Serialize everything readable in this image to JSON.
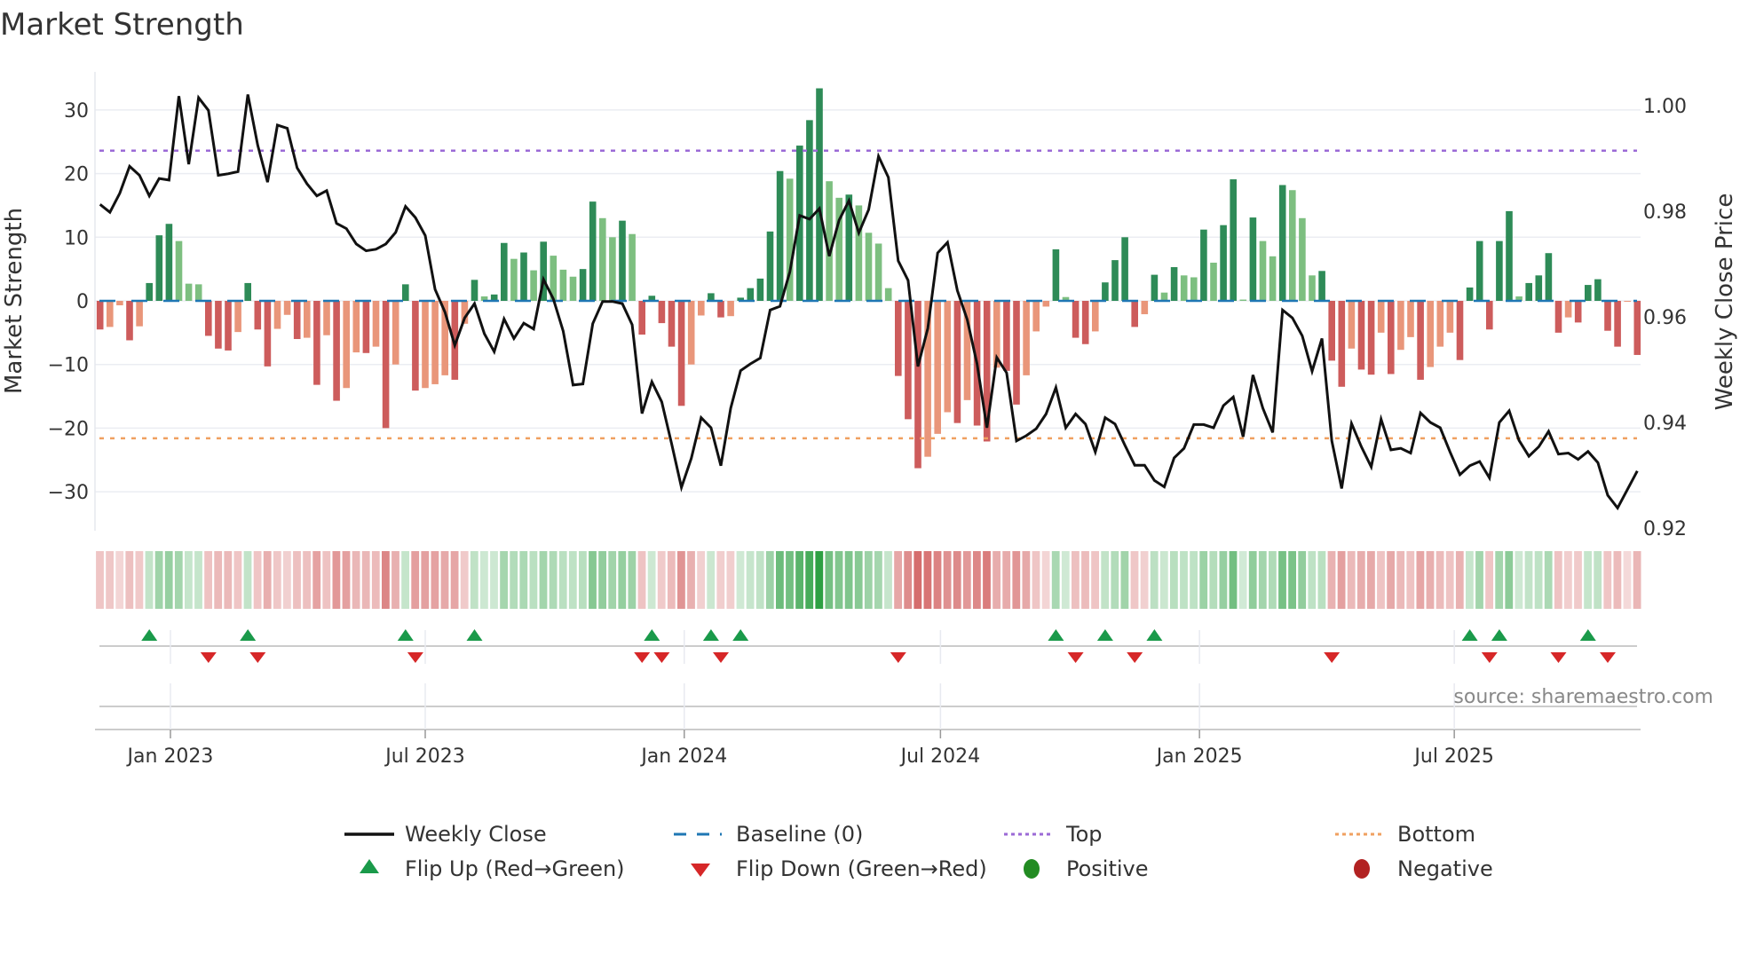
{
  "chart_data": {
    "type": "bar",
    "title": "Market Strength",
    "ylabel": "Market Strength",
    "y2label": "Weekly Close Price",
    "ylim": [
      -36,
      36
    ],
    "y2lim": [
      0.92,
      1.005
    ],
    "yticks": [
      30,
      20,
      10,
      0,
      -10,
      -20,
      -30
    ],
    "ytick_labels": [
      "30",
      "20",
      "10",
      "0",
      "−10",
      "−20",
      "−30"
    ],
    "y2ticks": [
      1.0,
      0.98,
      0.96,
      0.94,
      0.92
    ],
    "y2tick_labels": [
      "1.00",
      "0.98",
      "0.96",
      "0.94",
      "0.92"
    ],
    "x_start": "2022-11-12",
    "x_frequency": "weekly",
    "xticks": [
      "2023-01-01",
      "2023-07-01",
      "2024-01-01",
      "2024-07-01",
      "2025-01-01",
      "2025-07-01"
    ],
    "xtick_labels": [
      "Jan 2023",
      "Jul 2023",
      "Jan 2024",
      "Jul 2024",
      "Jan 2025",
      "Jul 2025"
    ],
    "top_level": 23.6,
    "bottom_level": -21.6,
    "baseline": 0,
    "strength": [
      -4.5,
      -4.1,
      -0.7,
      -6.2,
      -4,
      2.8,
      10.3,
      12.1,
      9.4,
      2.7,
      2.6,
      -5.5,
      -7.5,
      -7.8,
      -4.9,
      2.8,
      -4.5,
      -10.3,
      -4.4,
      -2.2,
      -6,
      -5.8,
      -13.2,
      -5.4,
      -15.7,
      -13.7,
      -8.1,
      -8.2,
      -7.2,
      -20,
      -10,
      2.6,
      -14.1,
      -13.7,
      -13.1,
      -11.7,
      -12.4,
      -3.6,
      3.3,
      0.7,
      1,
      9.1,
      6.6,
      7.6,
      4.8,
      9.3,
      7.1,
      4.9,
      3.8,
      5,
      15.6,
      13,
      10,
      12.6,
      10.5,
      -5.3,
      0.8,
      -3.5,
      -7.2,
      -16.5,
      -10,
      -2.3,
      1.2,
      -2.6,
      -2.4,
      0.5,
      2,
      3.5,
      10.9,
      20.4,
      19.2,
      24.4,
      28.4,
      33.4,
      18.8,
      16.2,
      16.7,
      15,
      10.7,
      9,
      2,
      -11.8,
      -18.6,
      -26.3,
      -24.5,
      -20.9,
      -17.5,
      -19.2,
      -15.6,
      -19.6,
      -22.1,
      -10.5,
      -11,
      -16.3,
      -11.7,
      -4.8,
      -0.9,
      8.1,
      0.6,
      -5.8,
      -6.8,
      -4.8,
      2.9,
      6.4,
      10,
      -4.1,
      -2.1,
      4.1,
      1.3,
      5.3,
      4,
      3.7,
      11.2,
      6,
      11.9,
      19.1,
      0.2,
      13.1,
      9.4,
      7,
      18.2,
      17.4,
      13,
      4,
      4.7,
      -9.4,
      -13.5,
      -7.5,
      -10.8,
      -11.6,
      -5,
      -11.5,
      -7.7,
      -5.7,
      -12.4,
      -10.4,
      -7.2,
      -5,
      -9.3,
      2.1,
      9.4,
      -4.5,
      9.4,
      14.1,
      0.7,
      2.8,
      4,
      7.5,
      -5,
      -2.6,
      -3.4,
      2.5,
      3.4,
      -4.7,
      -7.2,
      -0.1,
      -8.5
    ],
    "weekly_close": [
      0.9813,
      0.9798,
      0.9834,
      0.9885,
      0.9868,
      0.9829,
      0.9862,
      0.9859,
      1.0018,
      0.9889,
      1.0015,
      0.9991,
      0.9868,
      0.9871,
      0.9875,
      1.0021,
      0.9925,
      0.9855,
      0.9963,
      0.9957,
      0.9882,
      0.9852,
      0.9829,
      0.9839,
      0.9777,
      0.9767,
      0.9738,
      0.9725,
      0.9728,
      0.9738,
      0.976,
      0.9809,
      0.9788,
      0.9754,
      0.9652,
      0.9609,
      0.9546,
      0.9598,
      0.9625,
      0.9568,
      0.9534,
      0.9596,
      0.9559,
      0.9588,
      0.9577,
      0.9671,
      0.9634,
      0.9573,
      0.9471,
      0.9473,
      0.9587,
      0.9629,
      0.9629,
      0.9625,
      0.9585,
      0.9417,
      0.9477,
      0.9439,
      0.936,
      0.9277,
      0.9332,
      0.9409,
      0.939,
      0.9318,
      0.9427,
      0.9498,
      0.9511,
      0.9522,
      0.9613,
      0.962,
      0.9685,
      0.9792,
      0.9785,
      0.9805,
      0.9715,
      0.9783,
      0.982,
      0.9759,
      0.9803,
      0.9904,
      0.9864,
      0.9706,
      0.9669,
      0.9506,
      0.9578,
      0.9721,
      0.9741,
      0.965,
      0.9595,
      0.9511,
      0.939,
      0.9523,
      0.9494,
      0.9365,
      0.9375,
      0.9388,
      0.9416,
      0.9466,
      0.939,
      0.9416,
      0.9397,
      0.9344,
      0.9409,
      0.9397,
      0.9357,
      0.9319,
      0.9319,
      0.929,
      0.9278,
      0.9333,
      0.9351,
      0.9396,
      0.9396,
      0.939,
      0.9432,
      0.9448,
      0.9373,
      0.949,
      0.9427,
      0.9381,
      0.9613,
      0.9598,
      0.9564,
      0.9497,
      0.9559,
      0.9365,
      0.9275,
      0.9398,
      0.9354,
      0.9316,
      0.9406,
      0.9348,
      0.9351,
      0.9342,
      0.9418,
      0.94,
      0.939,
      0.9344,
      0.9301,
      0.9318,
      0.9326,
      0.9295,
      0.94,
      0.9422,
      0.9366,
      0.9336,
      0.9354,
      0.9383,
      0.934,
      0.9342,
      0.933,
      0.9345,
      0.9324,
      0.9262,
      0.9238,
      0.9273,
      0.9308
    ],
    "colors": {
      "pos_rising": "#2e8b57",
      "pos_falling": "#7dbf80",
      "neg_falling": "#cd5c5c",
      "neg_rising": "#e9967a",
      "line": "#111111",
      "baseline": "#1f77b4",
      "top": "#9b6ad6",
      "bottom": "#f0a060",
      "flip_up": "#1a9a4a",
      "flip_down": "#d62728",
      "positive": "#228b22",
      "negative": "#b22222",
      "grid": "#ebedf2"
    },
    "legend": {
      "placement": "bottom",
      "items": [
        {
          "label": "Weekly Close",
          "symbol": "line"
        },
        {
          "label": "Baseline (0)",
          "symbol": "dash"
        },
        {
          "label": "Top",
          "symbol": "dot-purple"
        },
        {
          "label": "Bottom",
          "symbol": "dot-orange"
        },
        {
          "label": "Flip Up (Red→Green)",
          "symbol": "triangle-up"
        },
        {
          "label": "Flip Down (Green→Red)",
          "symbol": "triangle-down"
        },
        {
          "label": "Positive",
          "symbol": "circle-green"
        },
        {
          "label": "Negative",
          "symbol": "circle-red"
        }
      ]
    },
    "source": "source: sharemaestro.com"
  }
}
